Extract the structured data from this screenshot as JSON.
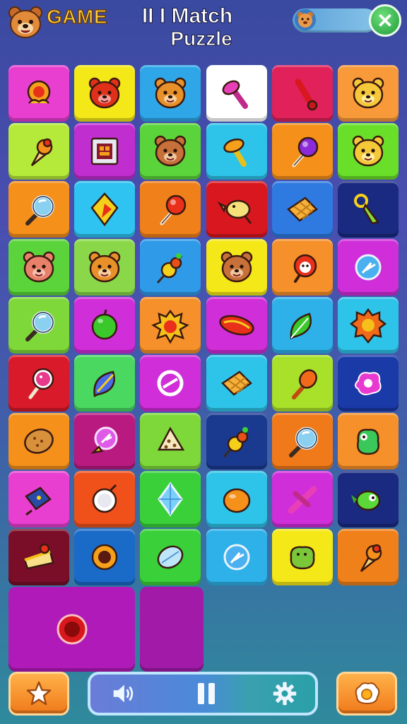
{
  "header": {
    "game_label": "GAME",
    "title_line1": "II I Match",
    "title_line2": "Puzzle",
    "score_icon": "bear-face-icon",
    "close_icon": "close-icon",
    "close_glyph": "✕"
  },
  "board": {
    "columns": 6,
    "rows": 10,
    "tiles": [
      {
        "bg": "#e83fd0",
        "icon": "orange-flower"
      },
      {
        "bg": "#f5e818",
        "icon": "red-bear"
      },
      {
        "bg": "#2ea6e8",
        "icon": "orange-bear"
      },
      {
        "bg": "#ffffff",
        "icon": "pink-mushroom"
      },
      {
        "bg": "#e0215a",
        "icon": "red-club"
      },
      {
        "bg": "#f89a3a",
        "icon": "yellow-bear"
      },
      {
        "bg": "#b6ea3a",
        "icon": "ice-cream"
      },
      {
        "bg": "#c02ed0",
        "icon": "framed-box"
      },
      {
        "bg": "#5ad43a",
        "icon": "brown-bear"
      },
      {
        "bg": "#2ec3e8",
        "icon": "yellow-mushroom"
      },
      {
        "bg": "#f5901a",
        "icon": "purple-lollipop"
      },
      {
        "bg": "#6adf2a",
        "icon": "yellow-bear"
      },
      {
        "bg": "#f5901a",
        "icon": "blue-magnifier"
      },
      {
        "bg": "#2ec3f0",
        "icon": "red-gem"
      },
      {
        "bg": "#f0801a",
        "icon": "red-lollipop"
      },
      {
        "bg": "#d8181e",
        "icon": "yellow-bird"
      },
      {
        "bg": "#2e7ae0",
        "icon": "waffle"
      },
      {
        "bg": "#1a2a80",
        "icon": "green-key"
      },
      {
        "bg": "#5ad43a",
        "icon": "pink-bear"
      },
      {
        "bg": "#8ad84a",
        "icon": "orange-bear"
      },
      {
        "bg": "#2e9ae8",
        "icon": "fruit-skewer"
      },
      {
        "bg": "#f5e818",
        "icon": "brown-bear"
      },
      {
        "bg": "#f5902a",
        "icon": "red-bear-lollipop"
      },
      {
        "bg": "#d02ed8",
        "icon": "blue-swirl"
      },
      {
        "bg": "#7ed83a",
        "icon": "blue-magnifier"
      },
      {
        "bg": "#d02ed8",
        "icon": "green-apple"
      },
      {
        "bg": "#f5902a",
        "icon": "red-splat"
      },
      {
        "bg": "#d02ed8",
        "icon": "hot-dog"
      },
      {
        "bg": "#2eb0e8",
        "icon": "green-leaf"
      },
      {
        "bg": "#2ec3e8",
        "icon": "orange-gear"
      },
      {
        "bg": "#d81a2a",
        "icon": "pink-lollipop"
      },
      {
        "bg": "#4ad860",
        "icon": "blue-leaf"
      },
      {
        "bg": "#d02ed8",
        "icon": "white-clock"
      },
      {
        "bg": "#2ec3e8",
        "icon": "waffle"
      },
      {
        "bg": "#a8e02a",
        "icon": "orange-club"
      },
      {
        "bg": "#1a3aa8",
        "icon": "pink-blob"
      },
      {
        "bg": "#f5901a",
        "icon": "cookie"
      },
      {
        "bg": "#b81a80",
        "icon": "purple-swirl"
      },
      {
        "bg": "#7ed83a",
        "icon": "cracker"
      },
      {
        "bg": "#1a3a90",
        "icon": "fruit-skewer"
      },
      {
        "bg": "#f07a1a",
        "icon": "blue-magnifier"
      },
      {
        "bg": "#f5902a",
        "icon": "green-frog"
      },
      {
        "bg": "#e83fd0",
        "icon": "blue-chip"
      },
      {
        "bg": "#f0501a",
        "icon": "white-plate"
      },
      {
        "bg": "#3ad03a",
        "icon": "blue-diamond"
      },
      {
        "bg": "#2ec3e8",
        "icon": "orange-fruit"
      },
      {
        "bg": "#d02ed8",
        "icon": "pink-cross"
      },
      {
        "bg": "#1a2a80",
        "icon": "green-bird"
      },
      {
        "bg": "#7a0e28",
        "icon": "cake-slice"
      },
      {
        "bg": "#1a6ac8",
        "icon": "orange-ring"
      },
      {
        "bg": "#3ad03a",
        "icon": "blue-leaf-oval"
      },
      {
        "bg": "#2eb0e8",
        "icon": "blue-swirl"
      },
      {
        "bg": "#f5e818",
        "icon": "green-blob"
      },
      {
        "bg": "#f0801a",
        "icon": "ice-cream"
      }
    ],
    "panels": [
      {
        "bg": "#b01ab8",
        "icon": "red-ring"
      },
      {
        "bg": "#a21aa8",
        "icon": ""
      }
    ]
  },
  "footer": {
    "left_icon": "star-icon",
    "sound_icon": "speaker-icon",
    "pause_icon": "pause-icon",
    "settings_icon": "gear-icon",
    "right_icon": "egg-icon"
  }
}
